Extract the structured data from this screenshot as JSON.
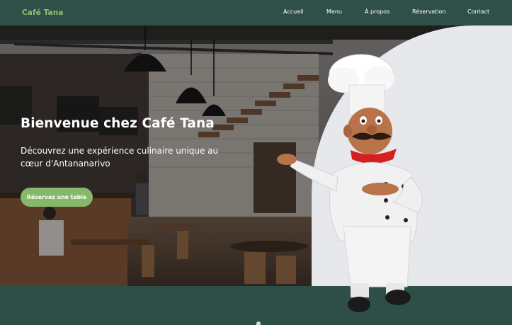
{
  "brand": "Café Tana",
  "nav": {
    "items": [
      "Accueil",
      "Menu",
      "À propos",
      "Réservation",
      "Contact"
    ]
  },
  "hero": {
    "title": "Bienvenue chez Café Tana",
    "subtitle": "Découvrez une expérience culinaire unique au cœur d'Antananarivo",
    "cta_label": "Réservez une table"
  },
  "colors": {
    "header_bg": "#2f5049",
    "brand": "#8fbf72",
    "cta": "#86b86b",
    "bottom_band": "#2d4f48",
    "panel": "#e7e8ec"
  },
  "icons": {
    "hero_image": "cafe-interior-photo",
    "mascot": "chef-mascot"
  }
}
